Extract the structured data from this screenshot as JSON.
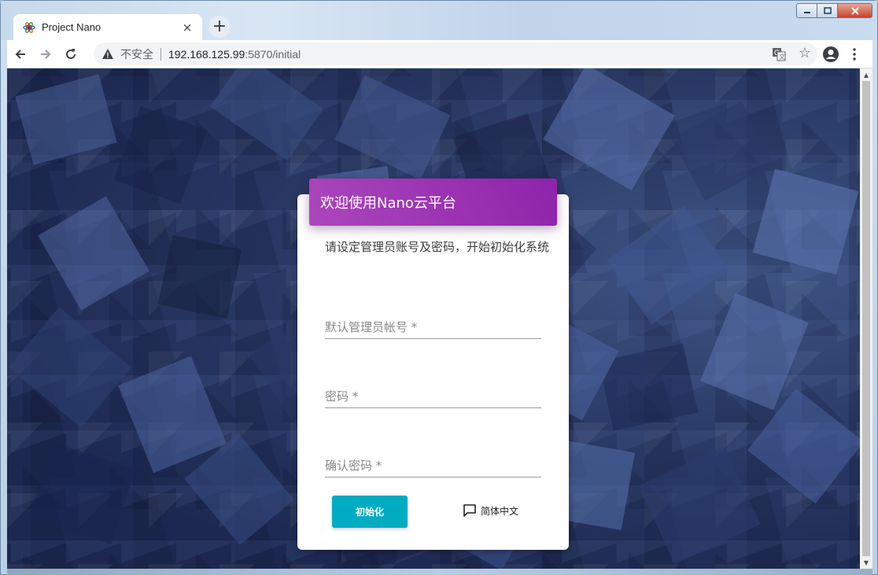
{
  "browser": {
    "tab_title": "Project Nano",
    "tab_close": "×",
    "new_tab": "+",
    "insecure_label": "不安全",
    "url_host": "192.168.125.99",
    "url_rest": ":5870/initial"
  },
  "card": {
    "title": "欢迎使用Nano云平台",
    "description": "请设定管理员账号及密码，开始初始化系统",
    "fields": {
      "username_placeholder": "默认管理员帐号 *",
      "password_placeholder": "密码 *",
      "confirm_placeholder": "确认密码 *"
    },
    "init_button": "初始化",
    "language_label": "简体中文"
  },
  "colors": {
    "header_accent": "#9c27b0",
    "button_accent": "#00acc1",
    "background": "#263560"
  }
}
